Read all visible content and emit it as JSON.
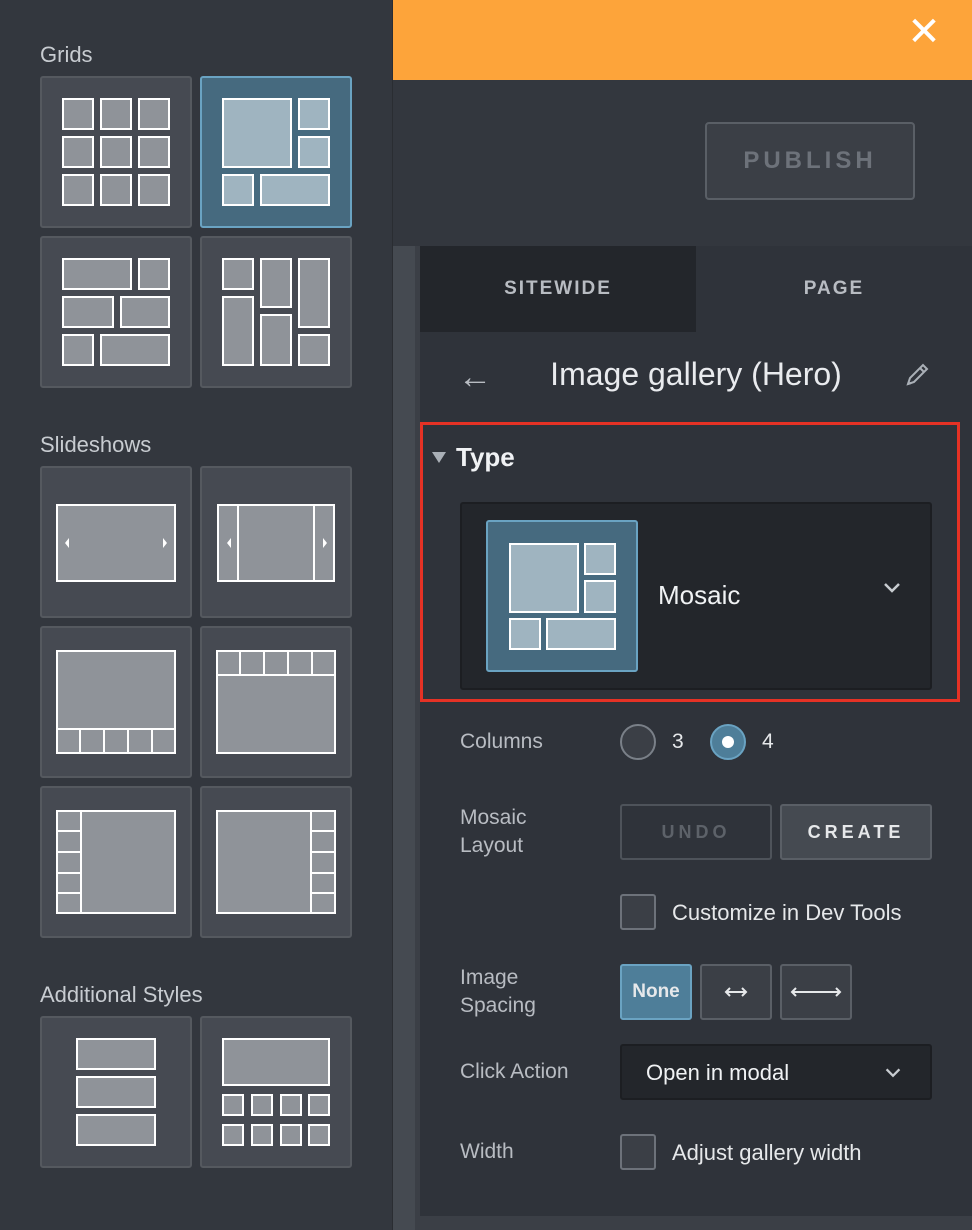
{
  "banner": {
    "close_icon": "close-icon"
  },
  "header": {
    "publish_label": "PUBLISH"
  },
  "left_panel": {
    "sections": [
      {
        "title": "Grids"
      },
      {
        "title": "Slideshows"
      },
      {
        "title": "Additional Styles"
      }
    ],
    "selected_tile": "grid-mosaic"
  },
  "tabs": [
    {
      "label": "SITEWIDE"
    },
    {
      "label": "PAGE"
    }
  ],
  "panel": {
    "title": "Image gallery (Hero)",
    "type_label": "Type",
    "type_value": "Mosaic",
    "columns_label": "Columns",
    "columns_options": [
      "3",
      "4"
    ],
    "columns_selected": "4",
    "mosaic_layout_label_1": "Mosaic",
    "mosaic_layout_label_2": "Layout",
    "undo_label": "UNDO",
    "create_label": "CREATE",
    "customize_label": "Customize in Dev Tools",
    "image_spacing_label_1": "Image",
    "image_spacing_label_2": "Spacing",
    "spacing_none_label": "None",
    "click_action_label": "Click Action",
    "click_action_value": "Open in modal",
    "width_label": "Width",
    "adjust_width_label": "Adjust gallery width"
  },
  "colors": {
    "banner": "#fda43a",
    "accent": "#4e7e99",
    "highlight_border": "#e53225",
    "panel_bg": "#2f333a"
  }
}
